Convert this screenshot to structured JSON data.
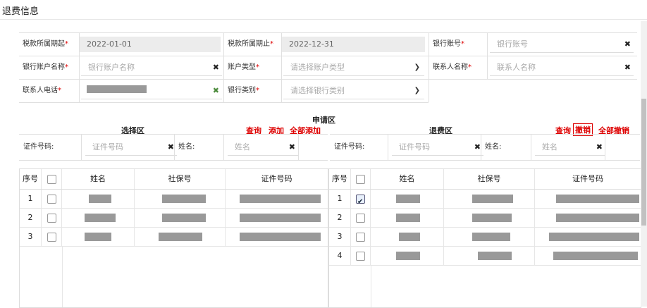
{
  "page_title": "退费信息",
  "form": {
    "row1": {
      "period_start_label": "税款所属期起",
      "period_start_value": "2022-01-01",
      "period_end_label": "税款所属期止",
      "period_end_value": "2022-12-31",
      "bank_account_label": "银行账号",
      "bank_account_placeholder": "银行账号"
    },
    "row2": {
      "account_name_label": "银行账户名称",
      "account_name_placeholder": "银行账户名称",
      "account_type_label": "账户类型",
      "account_type_placeholder": "请选择账户类型",
      "contact_name_label": "联系人名称",
      "contact_name_placeholder": "联系人名称"
    },
    "row3": {
      "contact_phone_label": "联系人电话",
      "bank_type_label": "银行类别",
      "bank_type_placeholder": "请选择银行类别"
    },
    "required_mark": "*"
  },
  "apply_area": {
    "title": "申请区"
  },
  "select_area": {
    "title": "选择区",
    "actions": {
      "query": "查询",
      "add": "添加",
      "add_all": "全部添加"
    },
    "filter": {
      "id_label": "证件号码:",
      "id_placeholder": "证件号码",
      "name_label": "姓名:",
      "name_placeholder": "姓名"
    },
    "columns": [
      "序号",
      "姓名",
      "社保号",
      "证件号码"
    ],
    "rows": [
      {
        "index": "1"
      },
      {
        "index": "2"
      },
      {
        "index": "3"
      }
    ]
  },
  "refund_area": {
    "title": "退费区",
    "actions": {
      "query": "查询",
      "revoke": "撤销",
      "revoke_all": "全部撤销"
    },
    "filter": {
      "id_label": "证件号码:",
      "id_placeholder": "证件号码",
      "name_label": "姓名:",
      "name_placeholder": "姓名"
    },
    "columns": [
      "序号",
      "姓名",
      "社保号",
      "证件号码"
    ],
    "rows": [
      {
        "index": "1",
        "checked": true
      },
      {
        "index": "2"
      },
      {
        "index": "3"
      },
      {
        "index": "4"
      }
    ]
  },
  "colors": {
    "accent_red": "#dd0000",
    "border": "#e0e0e0",
    "redaction": "#999999"
  }
}
